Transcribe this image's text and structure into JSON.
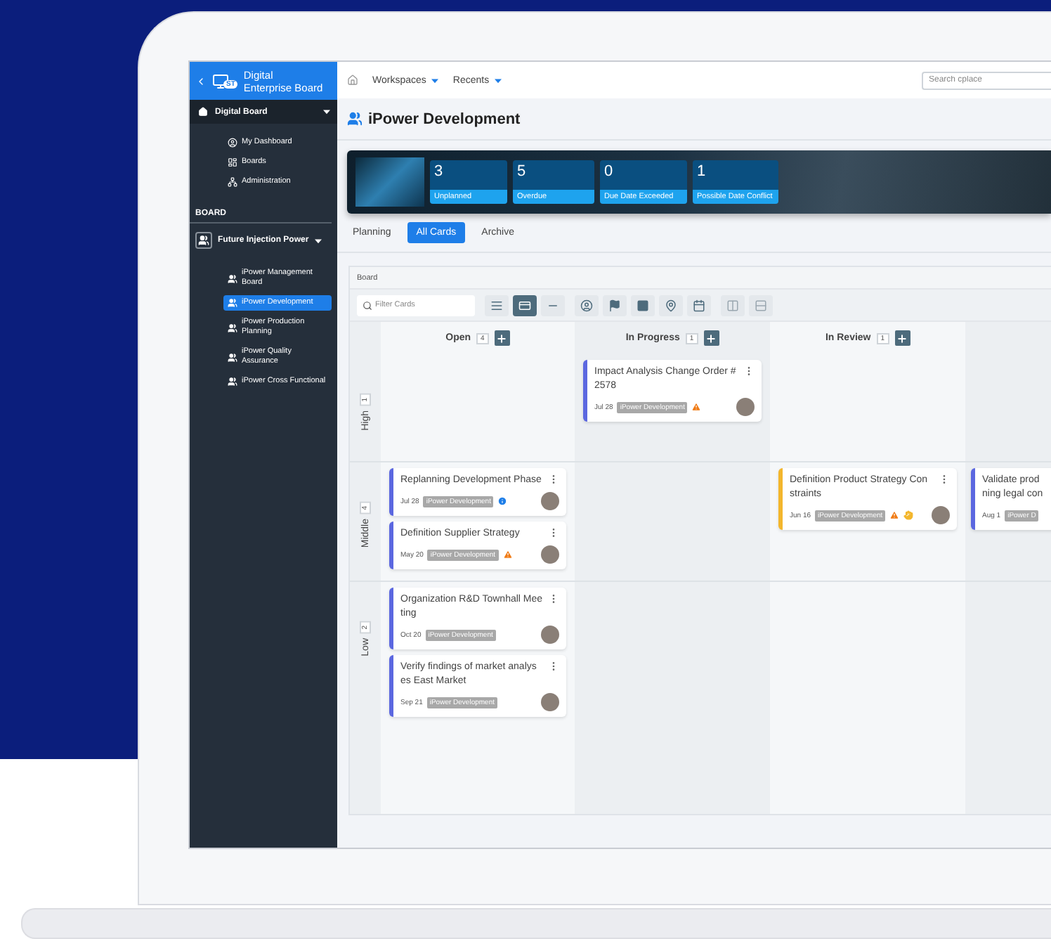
{
  "sidebar": {
    "title_lines": [
      "Digital",
      "Enterprise Board"
    ],
    "badge": "ST",
    "nav": {
      "label": "Digital Board",
      "expanded": true,
      "children": [
        {
          "label": "My Dashboard",
          "kind": "user"
        },
        {
          "label": "Boards",
          "kind": "board"
        },
        {
          "label": "Administration",
          "kind": "admin"
        }
      ]
    },
    "section": "BOARD",
    "board": {
      "label": "Future Injection Power",
      "expanded": true,
      "children": [
        {
          "label": "iPower Management Board",
          "selected": false
        },
        {
          "label": "iPower Development",
          "selected": true
        },
        {
          "label": "iPower Production Planning",
          "selected": false
        },
        {
          "label": "iPower Quality Assurance",
          "selected": false
        },
        {
          "label": "iPower Cross Functional",
          "selected": false
        }
      ]
    }
  },
  "topbar": {
    "menus": [
      "Workspaces",
      "Recents"
    ],
    "search": {
      "placeholder": "Search cplace"
    }
  },
  "page_title": "iPower Development",
  "stats": [
    {
      "value": "3",
      "label": "Unplanned"
    },
    {
      "value": "5",
      "label": "Overdue"
    },
    {
      "value": "0",
      "label": "Due Date Exceeded"
    },
    {
      "value": "1",
      "label": "Possible Date Conflict"
    }
  ],
  "tabs": [
    {
      "label": "Planning",
      "selected": false
    },
    {
      "label": "All Cards",
      "selected": true
    },
    {
      "label": "Archive",
      "selected": false
    }
  ],
  "board": {
    "title": "Board",
    "filter": {
      "placeholder": "Filter Cards"
    },
    "views": [
      {
        "kind": "compact",
        "selected": false
      },
      {
        "kind": "card",
        "selected": true
      },
      {
        "kind": "line",
        "selected": false
      }
    ],
    "columns": [
      {
        "title": "Open",
        "count": "4"
      },
      {
        "title": "In Progress",
        "count": "1"
      },
      {
        "title": "In Review",
        "count": "1"
      }
    ],
    "lanes": [
      {
        "name": "High",
        "count": "1",
        "cells": [
          [],
          [
            {
              "title_lines": [
                "Impact Analysis Change Order #",
                "2578"
              ],
              "date": "Jul 28",
              "tag": "iPower Development",
              "color": "#5b67e0",
              "alerts": [
                {
                  "kind": "warning"
                }
              ]
            }
          ],
          [],
          []
        ]
      },
      {
        "name": "Middle",
        "count": "4",
        "cells": [
          [
            {
              "title_lines": [
                "Replanning Development Phase"
              ],
              "date": "Jul 28",
              "tag": "iPower Development",
              "color": "#5b67e0",
              "alerts": [
                {
                  "kind": "info"
                }
              ]
            },
            {
              "title_lines": [
                "Definition Supplier Strategy"
              ],
              "date": "May 20",
              "tag": "iPower Development",
              "color": "#5b67e0",
              "alerts": [
                {
                  "kind": "warning"
                }
              ]
            }
          ],
          [],
          [
            {
              "title_lines": [
                "Definition Product Strategy Con",
                "straints"
              ],
              "date": "Jun 16",
              "tag": "iPower Development",
              "color": "#f3b62c",
              "alerts": [
                {
                  "kind": "warning"
                },
                {
                  "kind": "hand"
                }
              ]
            }
          ],
          [
            {
              "title_lines": [
                "Validate prod",
                "ning legal con"
              ],
              "date": "Aug 1",
              "tag": "iPower D",
              "color": "#5b67e0"
            }
          ]
        ]
      },
      {
        "name": "Low",
        "count": "2",
        "cells": [
          [
            {
              "title_lines": [
                "Organization R&D Townhall Mee",
                "ting"
              ],
              "date": "Oct 20",
              "tag": "iPower Development",
              "color": "#5b67e0"
            },
            {
              "title_lines": [
                "Verify findings of market analys",
                "es East Market"
              ],
              "date": "Sep 21",
              "tag": "iPower Development",
              "color": "#5b67e0"
            }
          ],
          [],
          [],
          []
        ]
      }
    ]
  }
}
